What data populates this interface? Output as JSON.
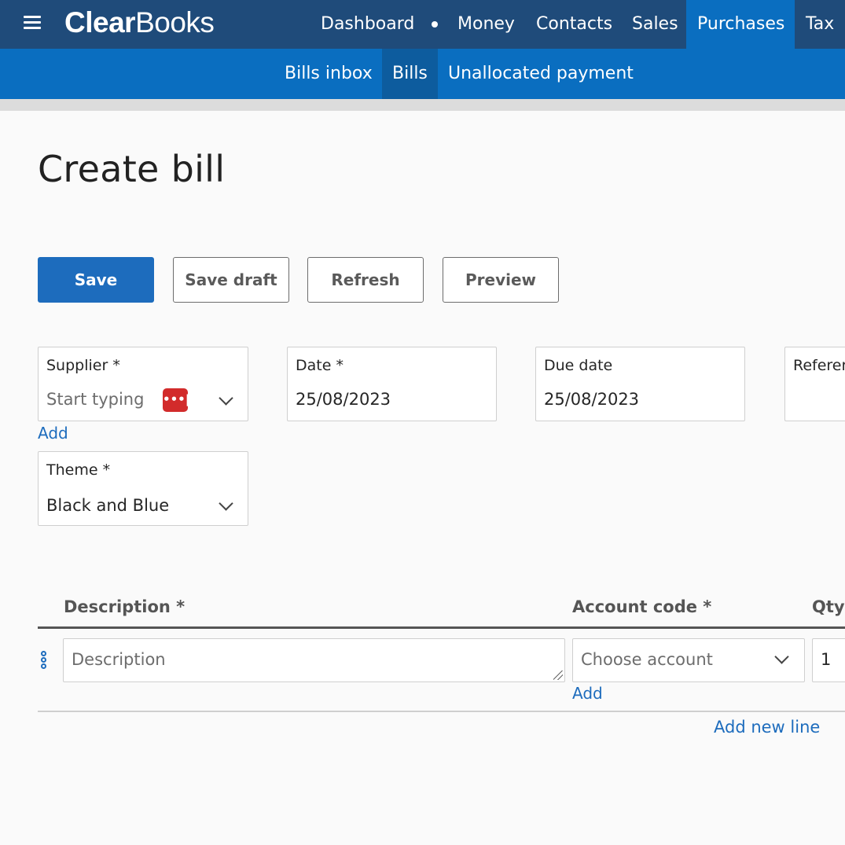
{
  "app": {
    "logo_bold": "Clear",
    "logo_light": "Books"
  },
  "topnav": {
    "items": [
      {
        "label": "Dashboard"
      },
      {
        "label": "Money"
      },
      {
        "label": "Contacts"
      },
      {
        "label": "Sales"
      },
      {
        "label": "Purchases",
        "active": true
      },
      {
        "label": "Tax"
      }
    ]
  },
  "subnav": {
    "items": [
      {
        "label": "Bills inbox"
      },
      {
        "label": "Bills",
        "active": true
      },
      {
        "label": "Unallocated payment"
      }
    ]
  },
  "page": {
    "title": "Create bill"
  },
  "actions": {
    "save": "Save",
    "save_draft": "Save draft",
    "refresh": "Refresh",
    "preview": "Preview"
  },
  "form": {
    "supplier": {
      "label": "Supplier *",
      "placeholder": "Start typing",
      "add_link": "Add",
      "password_icon_text": "•••|"
    },
    "date": {
      "label": "Date *",
      "value": "25/08/2023"
    },
    "due_date": {
      "label": "Due date",
      "value": "25/08/2023"
    },
    "reference": {
      "label": "Referer"
    },
    "theme": {
      "label": "Theme *",
      "value": "Black and Blue"
    }
  },
  "line_items": {
    "headers": {
      "description": "Description *",
      "account_code": "Account code *",
      "qty": "Qty"
    },
    "row": {
      "description_placeholder": "Description",
      "account_placeholder": "Choose account",
      "account_add_link": "Add",
      "qty": "1"
    },
    "add_new_line": "Add new line"
  },
  "colors": {
    "topbar": "#1f4b7a",
    "subbar": "#0a6ec0",
    "primary": "#1d6cbd",
    "password_icon": "#d22b2b"
  },
  "icons": [
    "menu-icon",
    "chevron-down-icon",
    "password-manager-icon",
    "drag-handle-icon",
    "resize-grip-icon"
  ]
}
